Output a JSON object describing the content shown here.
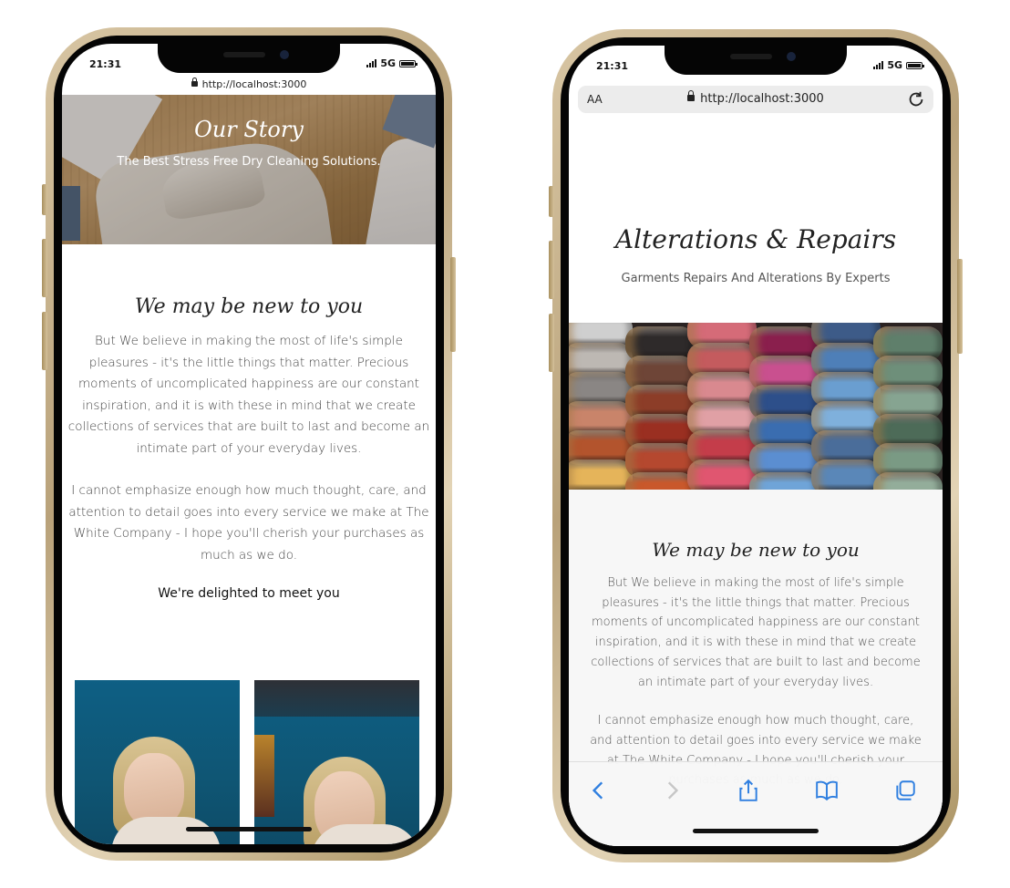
{
  "left_phone": {
    "status": {
      "time": "21:31",
      "network": "5G"
    },
    "url": "http://localhost:3000",
    "hero": {
      "title": "Our Story",
      "subtitle": "The Best Stress Free Dry Cleaning Solutions."
    },
    "section": {
      "heading": "We may be new to you",
      "paragraph1": "But We believe in making the most of life's simple pleasures - it's the little things that matter. Precious moments of uncomplicated happiness are our constant inspiration, and it is with these in mind that we create collections of services that are built to last and become an intimate part of your everyday lives.",
      "paragraph2": "I cannot emphasize enough how much thought, care, and attention to detail goes into every service we make at The White Company - I hope you'll cherish your purchases as much as we do.",
      "closing": "We're delighted to meet you"
    }
  },
  "right_phone": {
    "status": {
      "time": "21:31",
      "network": "5G"
    },
    "url_bar": {
      "text_size_label": "AA",
      "url": "http://localhost:3000"
    },
    "title": "Alterations & Repairs",
    "subtitle": "Garments Repairs And Alterations By Experts",
    "section": {
      "heading": "We may be new to you",
      "paragraph1": "But We believe in making the most of life's simple pleasures - it's the little things that matter. Precious moments of uncomplicated happiness are our constant inspiration, and it is with these in mind that we create collections of services that are built to last and become an intimate part of your everyday lives.",
      "paragraph2": "I cannot emphasize enough how much thought, care, and attention to detail goes into every service we make at The White Company - I hope you'll cherish your purchases as much as we do."
    },
    "toolbar_icons": [
      "back-icon",
      "forward-icon",
      "share-icon",
      "bookmarks-icon",
      "tabs-icon"
    ]
  },
  "colors": {
    "safari_blue": "#2f7fe0",
    "frame_gold": "#c8b38c",
    "section_bg": "#f7f7f7"
  }
}
